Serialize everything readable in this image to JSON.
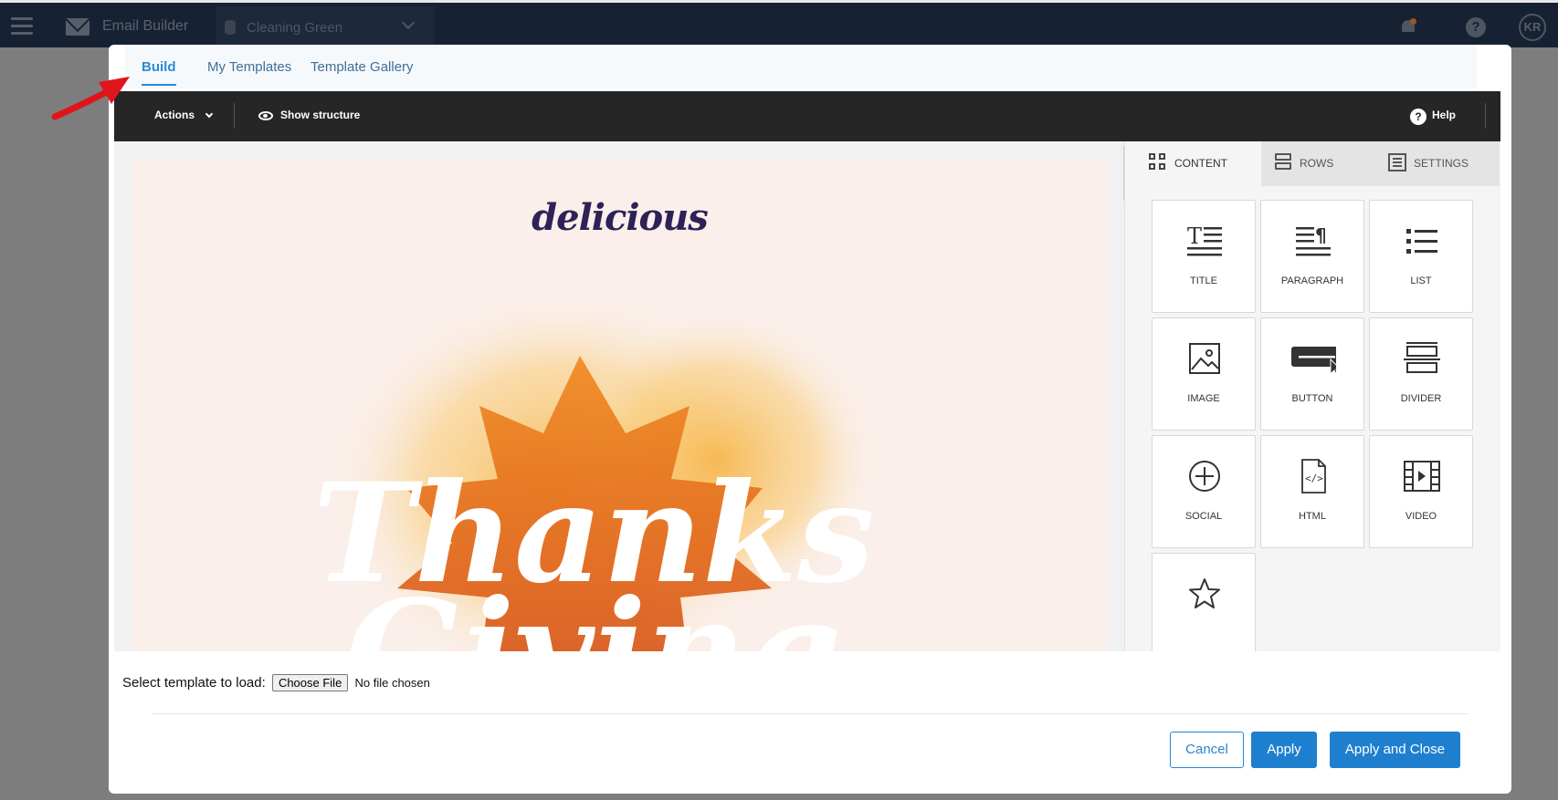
{
  "app": {
    "title": "Email Builder",
    "workspace": "Cleaning Green",
    "avatar_initials": "KR"
  },
  "modal": {
    "tabs": [
      {
        "label": "Build",
        "active": true
      },
      {
        "label": "My Templates",
        "active": false
      },
      {
        "label": "Template Gallery",
        "active": false
      }
    ],
    "toolbar": {
      "actions_label": "Actions",
      "show_structure_label": "Show structure",
      "help_label": "Help"
    },
    "email_preview": {
      "logo_text": "delicious",
      "hero_text_line1": "Thanks",
      "hero_text_line2": "Giving"
    },
    "panel": {
      "tabs": [
        {
          "label": "CONTENT",
          "icon": "grid-icon",
          "active": true
        },
        {
          "label": "ROWS",
          "icon": "rows-icon",
          "active": false
        },
        {
          "label": "SETTINGS",
          "icon": "settings-icon",
          "active": false
        }
      ],
      "blocks": [
        {
          "label": "TITLE",
          "icon": "title-icon"
        },
        {
          "label": "PARAGRAPH",
          "icon": "paragraph-icon"
        },
        {
          "label": "LIST",
          "icon": "list-icon"
        },
        {
          "label": "IMAGE",
          "icon": "image-icon"
        },
        {
          "label": "BUTTON",
          "icon": "button-icon"
        },
        {
          "label": "DIVIDER",
          "icon": "divider-icon"
        },
        {
          "label": "SOCIAL",
          "icon": "social-icon"
        },
        {
          "label": "HTML",
          "icon": "html-icon"
        },
        {
          "label": "VIDEO",
          "icon": "video-icon"
        },
        {
          "label": "",
          "icon": "star-icon"
        }
      ]
    },
    "file_load": {
      "label": "Select template to load:",
      "button_label": "Choose File",
      "status": "No file chosen"
    },
    "footer": {
      "cancel_label": "Cancel",
      "apply_label": "Apply",
      "apply_close_label": "Apply and Close"
    }
  },
  "colors": {
    "primary": "#1f7fcf",
    "toolbar_bg": "#262626",
    "email_bg": "#faefea",
    "annotation_arrow": "#e0151c"
  }
}
